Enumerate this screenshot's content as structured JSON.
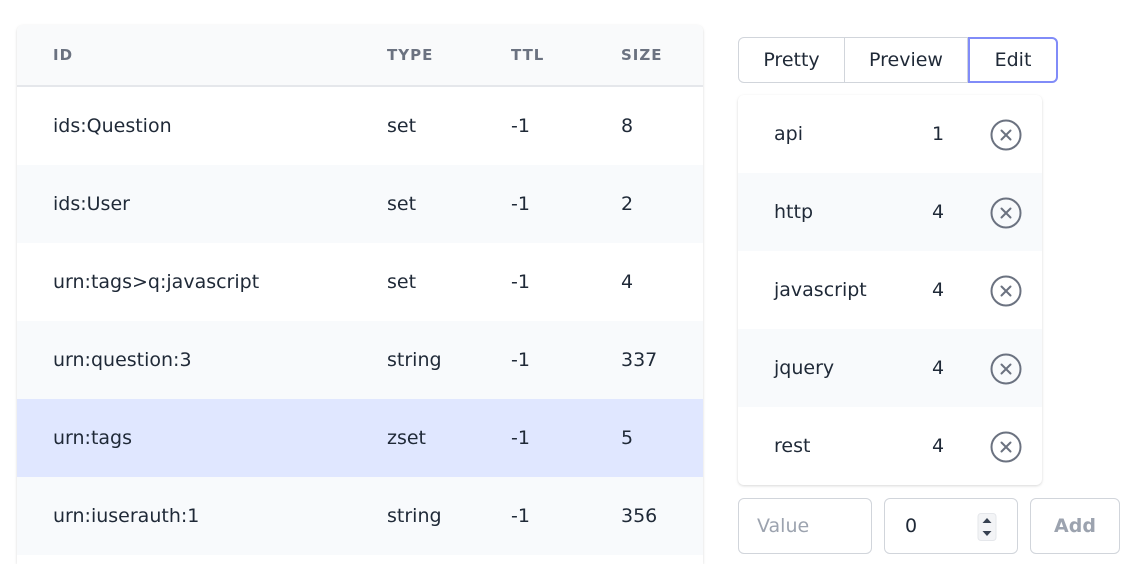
{
  "keys_table": {
    "headers": {
      "id": "ID",
      "type": "TYPE",
      "ttl": "TTL",
      "size": "SIZE"
    },
    "rows": [
      {
        "id": "ids:Question",
        "type": "set",
        "ttl": "-1",
        "size": "8"
      },
      {
        "id": "ids:User",
        "type": "set",
        "ttl": "-1",
        "size": "2"
      },
      {
        "id": "urn:tags>q:javascript",
        "type": "set",
        "ttl": "-1",
        "size": "4"
      },
      {
        "id": "urn:question:3",
        "type": "string",
        "ttl": "-1",
        "size": "337"
      },
      {
        "id": "urn:tags",
        "type": "zset",
        "ttl": "-1",
        "size": "5"
      },
      {
        "id": "urn:iuserauth:1",
        "type": "string",
        "ttl": "-1",
        "size": "356"
      }
    ],
    "selected_index": 4
  },
  "view_tabs": {
    "pretty": "Pretty",
    "preview": "Preview",
    "edit": "Edit",
    "active": "edit"
  },
  "members": [
    {
      "value": "api",
      "score": "1"
    },
    {
      "value": "http",
      "score": "4"
    },
    {
      "value": "javascript",
      "score": "4"
    },
    {
      "value": "jquery",
      "score": "4"
    },
    {
      "value": "rest",
      "score": "4"
    }
  ],
  "add_member": {
    "value_placeholder": "Value",
    "score_value": "0",
    "add_label": "Add"
  },
  "colors": {
    "selected_row": "#e0e7ff",
    "active_tab_border": "#818cf8",
    "stripe": "#f8fafc"
  }
}
